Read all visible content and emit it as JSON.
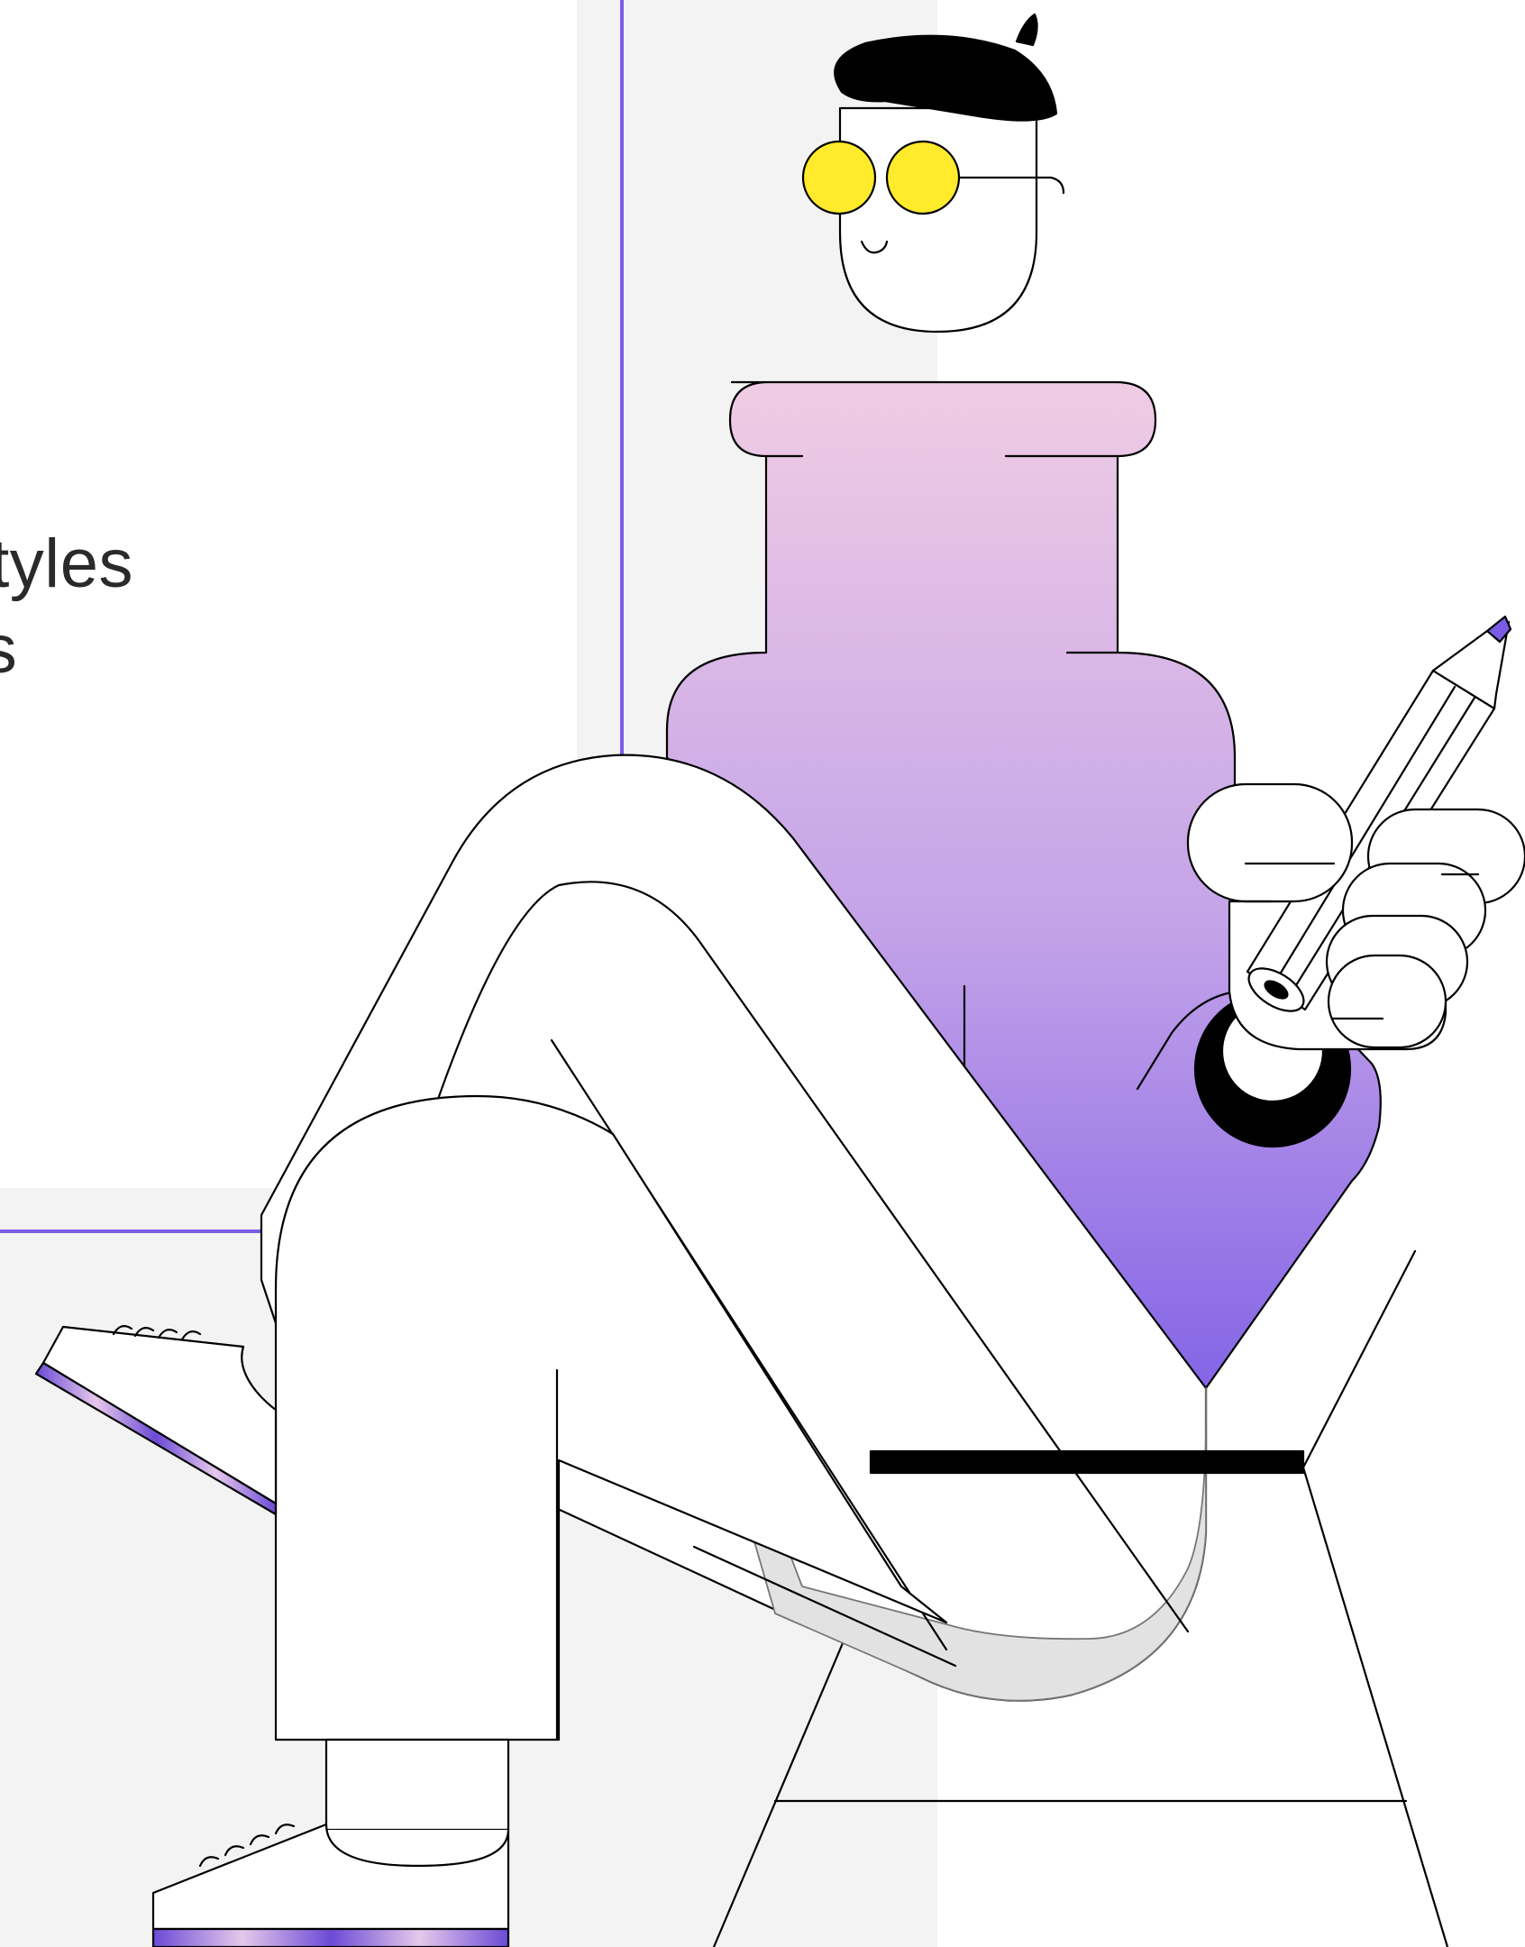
{
  "text_lines": [
    "Styles",
    "es"
  ],
  "colors": {
    "accent": "#7a5be6",
    "background_panel": "#f3f3f3",
    "glasses_yellow": "#ffea2b",
    "sweater_top": "#f0cce4",
    "sweater_bottom": "#7a5be6",
    "outline": "#000000",
    "chair_shadow": "#e2e2e2"
  },
  "illustration": {
    "subject": "seated-person-with-pencil",
    "parts": [
      "beret",
      "yellow-glasses",
      "head",
      "gradient-sweater",
      "crossed-legs",
      "hand-with-pencil",
      "wristband",
      "sneakers",
      "stool"
    ]
  }
}
